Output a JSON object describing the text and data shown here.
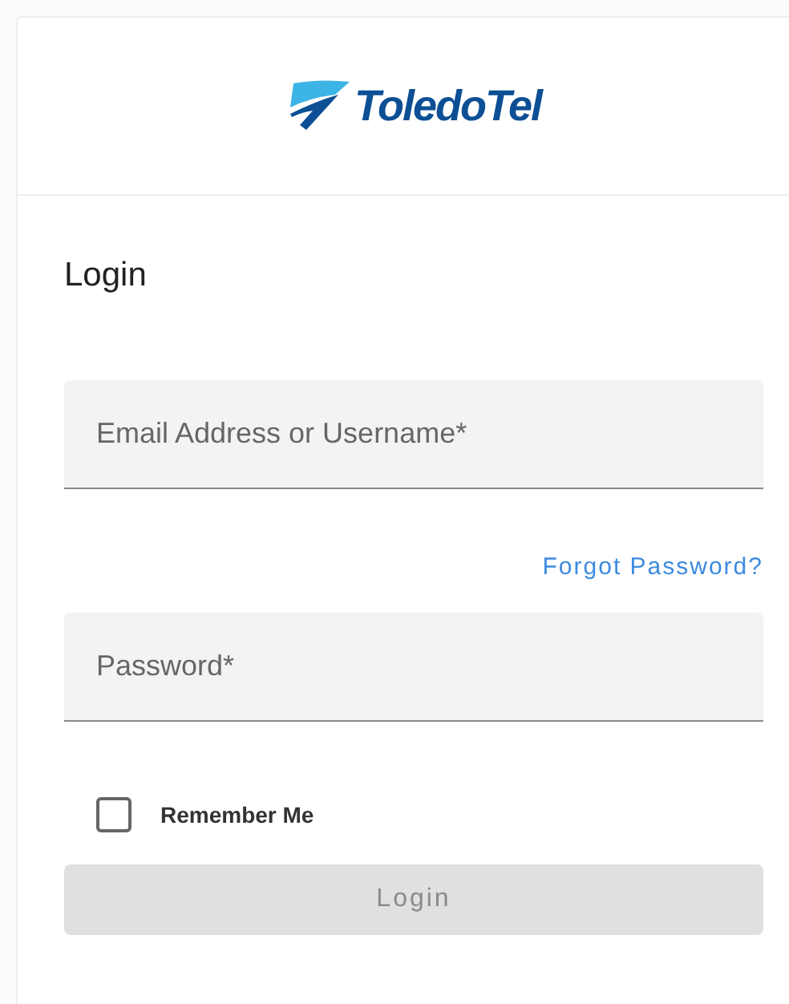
{
  "logo": {
    "text": "ToledoTel"
  },
  "form": {
    "title": "Login",
    "fields": [
      {
        "placeholder": "Email Address or Username*"
      },
      {
        "placeholder": "Password*"
      }
    ],
    "forgot_link": "Forgot Password?",
    "remember": {
      "label": "Remember Me",
      "checked": false
    },
    "submit": {
      "label": "Login",
      "disabled": true
    }
  }
}
